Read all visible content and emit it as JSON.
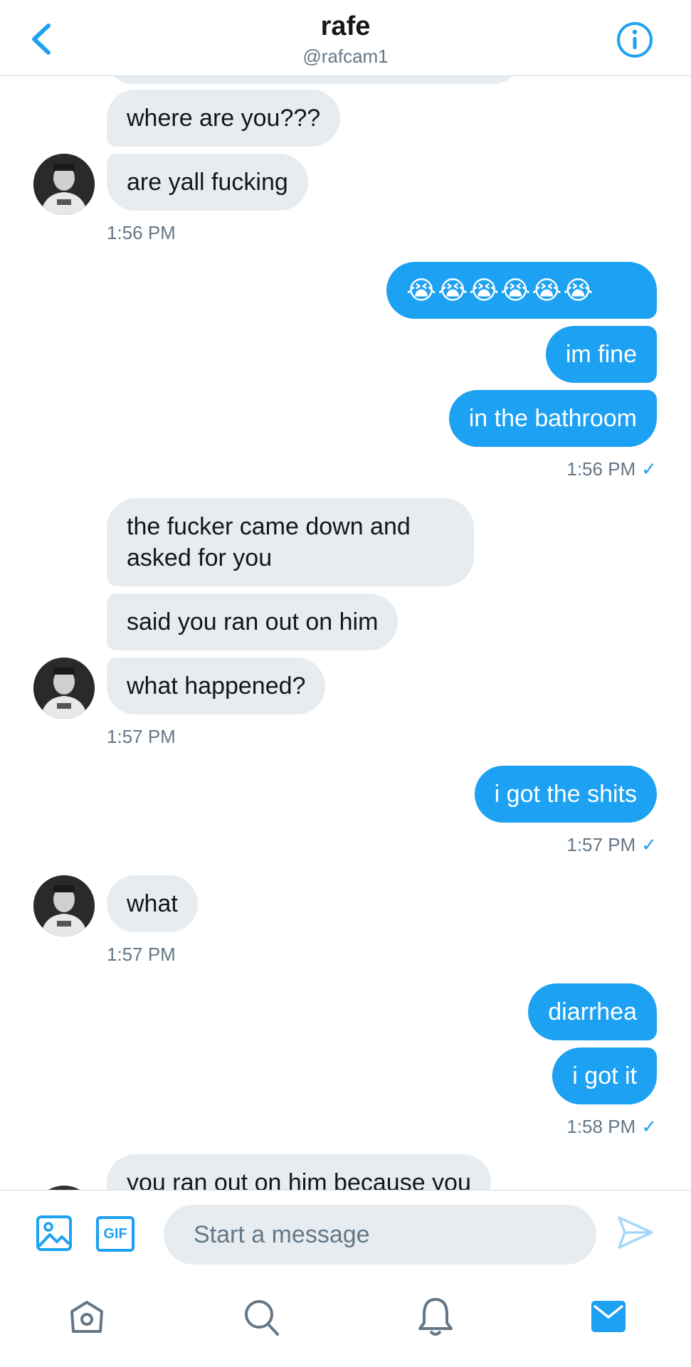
{
  "header": {
    "title": "rafe",
    "handle": "@rafcam1"
  },
  "messages": {
    "m0": "where are you???",
    "m1": "are yall fucking",
    "t1": "1:56 PM",
    "m2": "😭😭😭😭😭😭",
    "m3": "im fine",
    "m4": "in the bathroom",
    "t2": "1:56 PM",
    "m5": "the fucker came down and asked for you",
    "m6": "said you ran out on him",
    "m7": "what happened?",
    "t3": "1:57 PM",
    "m8": "i got the shits",
    "t4": "1:57 PM",
    "m9": "what",
    "t5": "1:57 PM",
    "m10": "diarrhea",
    "m11": "i got it",
    "t6": "1:58 PM",
    "m12": "you ran out on him because you",
    "read_mark": "✓"
  },
  "composer": {
    "placeholder": "Start a message",
    "gif_label": "GIF"
  },
  "icons": {
    "back": "chevron-left-icon",
    "info": "info-icon",
    "image": "image-icon",
    "gif": "gif-icon",
    "send": "send-icon",
    "home": "home-icon",
    "search": "search-icon",
    "notifications": "bell-icon",
    "messages": "mail-icon"
  },
  "colors": {
    "accent": "#1da1f2",
    "incoming_bubble": "#e6ecf0",
    "secondary_text": "#657786"
  }
}
